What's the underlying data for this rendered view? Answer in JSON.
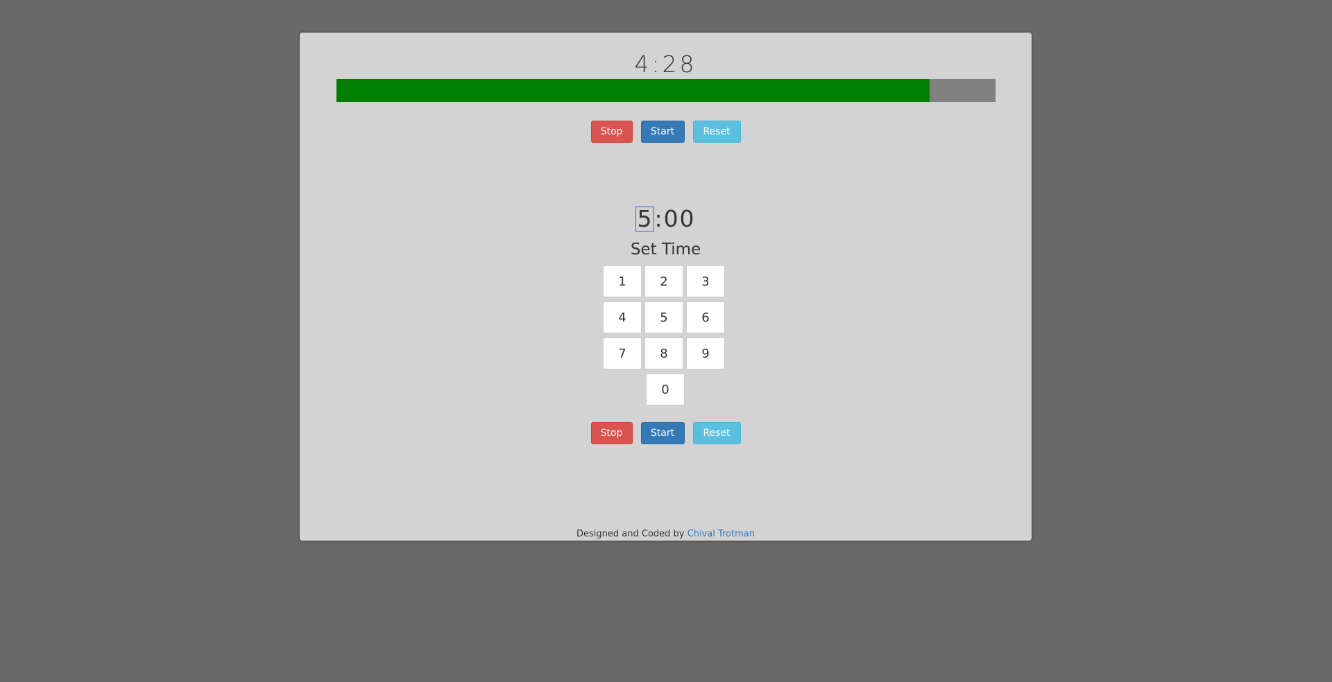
{
  "timer": {
    "countdown": "4:28",
    "progress_fraction": 0.9
  },
  "top_controls": {
    "stop_label": "Stop",
    "start_label": "Start",
    "reset_label": "Reset"
  },
  "setter": {
    "minutes": "5",
    "separator": ":",
    "seconds": "00",
    "label": "Set Time",
    "keys": [
      "1",
      "2",
      "3",
      "4",
      "5",
      "6",
      "7",
      "8",
      "9",
      "0"
    ]
  },
  "bottom_controls": {
    "stop_label": "Stop",
    "start_label": "Start",
    "reset_label": "Reset"
  },
  "footer": {
    "prefix": "Designed and Coded by",
    "author_link": "Chival Trotman"
  },
  "colors": {
    "background": "#696969",
    "card": "#d3d3d3",
    "progress_fill": "#008000",
    "progress_track": "#808080",
    "stop": "#d9534f",
    "start": "#337ab7",
    "reset": "#5bc0de"
  }
}
